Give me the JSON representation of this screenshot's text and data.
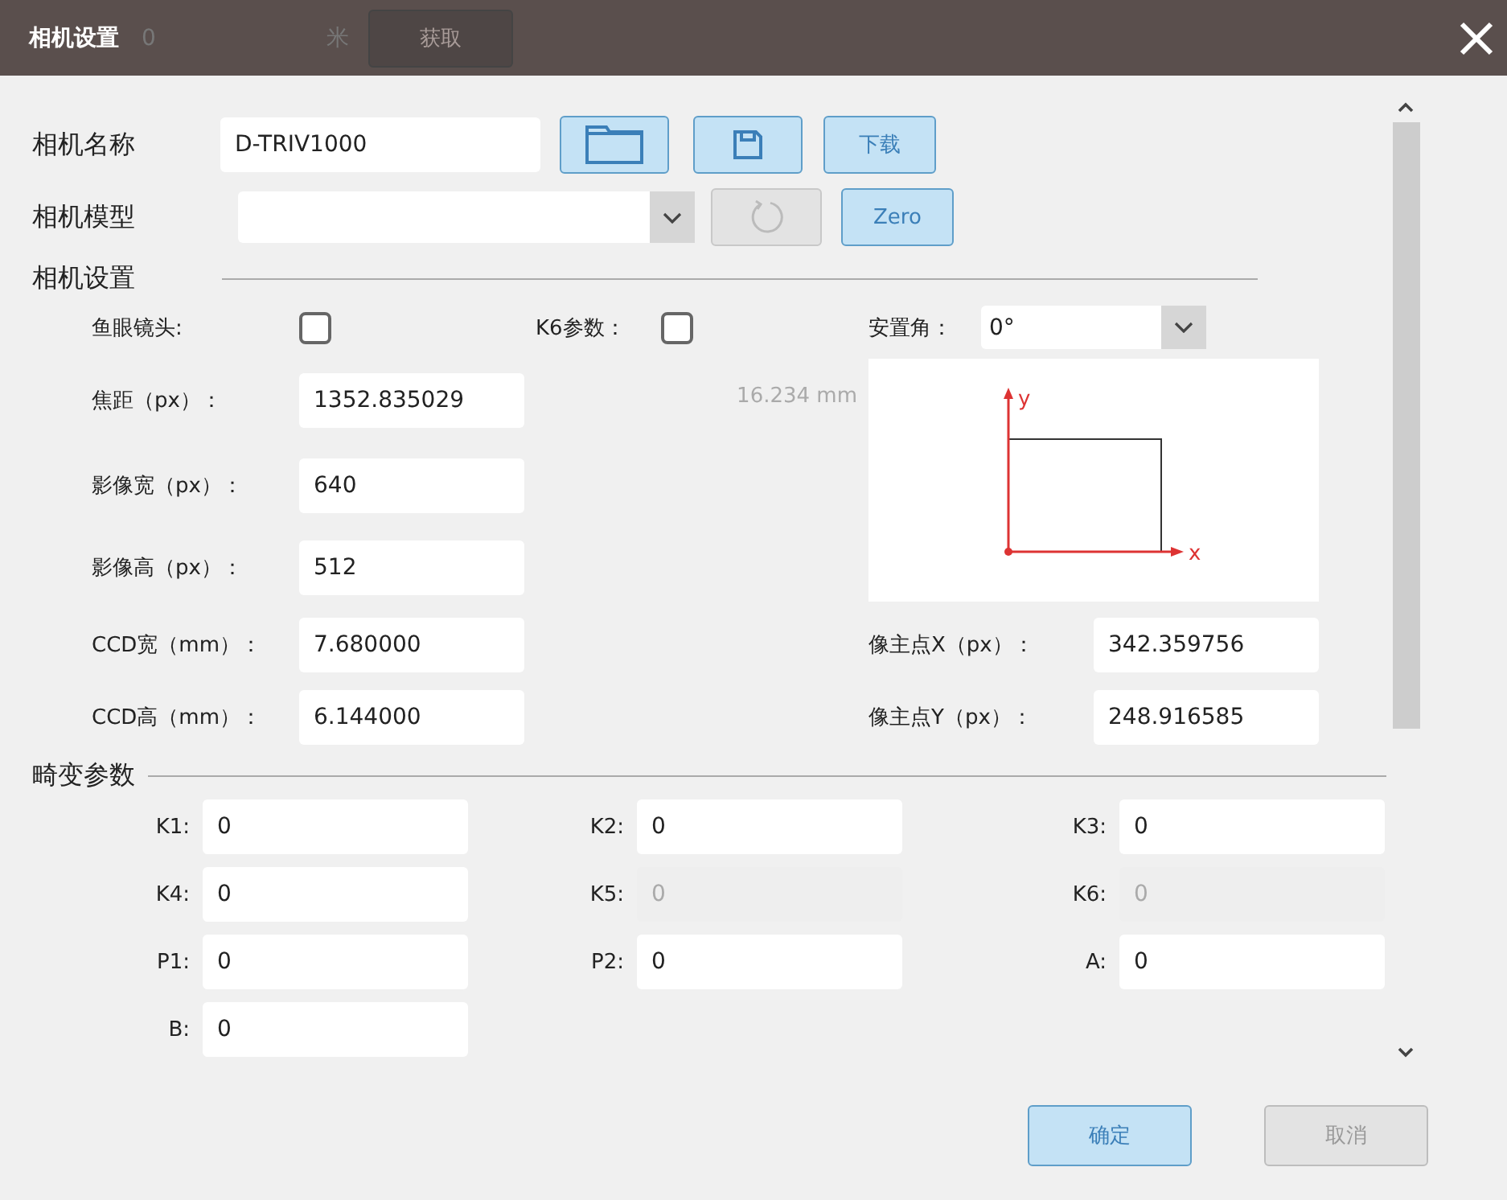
{
  "window": {
    "title": "相机设置",
    "behind_texts": [
      "0",
      "米"
    ],
    "behind_button": "获取"
  },
  "camera": {
    "name_label": "相机名称",
    "name_value": "D-TRIV1000",
    "download_button": "下载",
    "model_label": "相机模型",
    "reset_disabled": true,
    "zero_button": "Zero"
  },
  "settings": {
    "heading": "相机设置",
    "checks": [
      {
        "label": "鱼眼镜头:",
        "checked": false
      },
      {
        "label": "K6参数：",
        "checked": false
      }
    ],
    "mount_angle": {
      "label": "安置角：",
      "value": "0°"
    },
    "fields": [
      {
        "label": "焦距（px）：",
        "value": "1352.835029"
      },
      {
        "label": "影像宽（px）：",
        "value": "640"
      },
      {
        "label": "影像高（px）：",
        "value": "512"
      },
      {
        "label": "CCD宽（mm）：",
        "value": "7.680000"
      },
      {
        "label": "CCD高（mm）：",
        "value": "6.144000"
      }
    ],
    "focal_mm": "16.234 mm",
    "axes": {
      "y": "y",
      "x": "x"
    },
    "principal": [
      {
        "label": "像主点X（px）：",
        "value": "342.359756"
      },
      {
        "label": "像主点Y（px）：",
        "value": "248.916585"
      }
    ]
  },
  "distortion": {
    "heading": "畸变参数",
    "params": [
      {
        "label": "K1:",
        "value": "0",
        "disabled": false
      },
      {
        "label": "K2:",
        "value": "0",
        "disabled": false
      },
      {
        "label": "K3:",
        "value": "0",
        "disabled": false
      },
      {
        "label": "K4:",
        "value": "0",
        "disabled": false
      },
      {
        "label": "K5:",
        "value": "0",
        "disabled": true
      },
      {
        "label": "K6:",
        "value": "0",
        "disabled": true
      },
      {
        "label": "P1:",
        "value": "0",
        "disabled": false
      },
      {
        "label": "P2:",
        "value": "0",
        "disabled": false
      },
      {
        "label": "A:",
        "value": "0",
        "disabled": false
      },
      {
        "label": "B:",
        "value": "0",
        "disabled": false
      }
    ]
  },
  "buttons": [
    {
      "label": "确定",
      "kind": "confirm",
      "disabled": false
    },
    {
      "label": "取消",
      "kind": "cancel",
      "disabled": true
    }
  ]
}
